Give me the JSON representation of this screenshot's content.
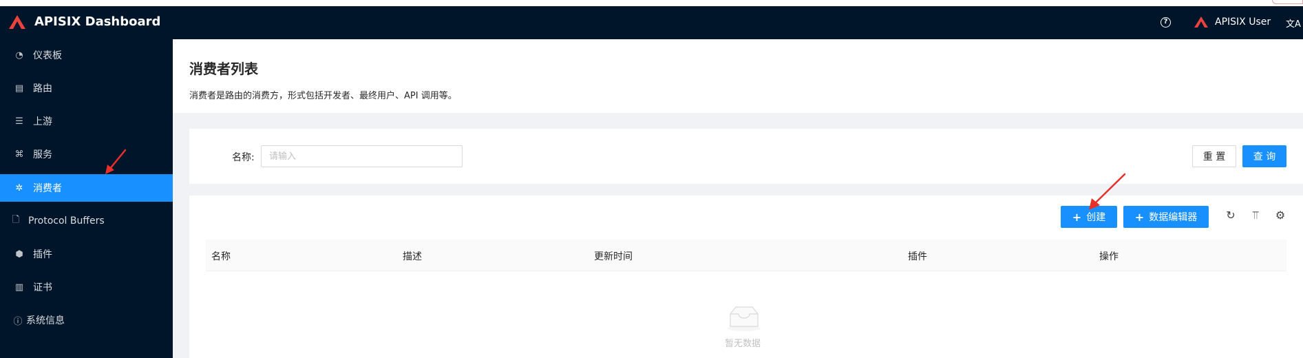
{
  "header": {
    "app_title": "APISIX Dashboard",
    "user_name": "APISIX User",
    "help_icon_glyph": "?",
    "lang_icon_glyph": "文A"
  },
  "sidebar": {
    "items": [
      {
        "label": "仪表板",
        "icon": "dashboard-icon",
        "glyph": "◔"
      },
      {
        "label": "路由",
        "icon": "route-icon",
        "glyph": "▤"
      },
      {
        "label": "上游",
        "icon": "upstream-icon",
        "glyph": "☰"
      },
      {
        "label": "服务",
        "icon": "service-icon",
        "glyph": "⌘"
      },
      {
        "label": "消费者",
        "icon": "consumer-icon",
        "glyph": "✲",
        "active": true
      },
      {
        "label": "Protocol Buffers",
        "icon": "file-icon",
        "glyph": "🗋"
      },
      {
        "label": "插件",
        "icon": "plugin-icon",
        "glyph": "⬢"
      },
      {
        "label": "证书",
        "icon": "certificate-icon",
        "glyph": "▥"
      },
      {
        "label": "系统信息",
        "icon": "info-icon",
        "glyph": "ⓘ"
      }
    ]
  },
  "page": {
    "title": "消费者列表",
    "description": "消费者是路由的消费方，形式包括开发者、最终用户、API 调用等。"
  },
  "search": {
    "name_label": "名称:",
    "name_placeholder": "请输入",
    "reset_label": "重 置",
    "query_label": "查 询"
  },
  "toolbar": {
    "create_label": "创建",
    "data_editor_label": "数据编辑器",
    "reload_glyph": "↻",
    "density_glyph": "⫪",
    "settings_glyph": "⚙"
  },
  "table": {
    "columns": [
      "名称",
      "描述",
      "更新时间",
      "插件",
      "操作"
    ],
    "empty_text": "暂无数据"
  },
  "colors": {
    "header_bg": "#001529",
    "primary": "#1890ff",
    "annotation_arrow": "#e8302a",
    "logo": "#e8433e"
  }
}
